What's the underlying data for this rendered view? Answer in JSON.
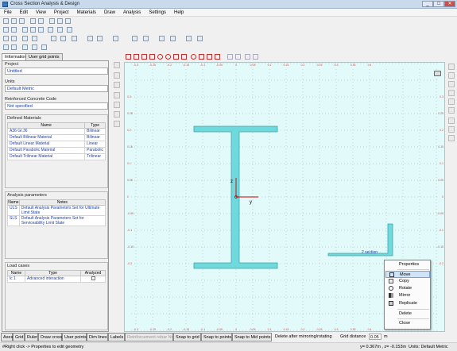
{
  "window": {
    "title": "Cross Section Analysis & Design",
    "controls": [
      "_",
      "□",
      "✕"
    ]
  },
  "menu": [
    "File",
    "Edit",
    "View",
    "Project",
    "Materials",
    "Draw",
    "Analysis",
    "Settings",
    "Help"
  ],
  "panel": {
    "tabs": [
      "Information",
      "User grid points"
    ],
    "project_label": "Project",
    "project_value": "Untitled",
    "units_label": "Units",
    "units_value": "Default Metric",
    "code_label": "Reinforced Concrete Code",
    "code_value": "Not specified",
    "materials": {
      "title": "Defined Materials",
      "headers": [
        "Name",
        "Type"
      ],
      "rows": [
        {
          "name": "A36 Gr.36",
          "type": "Bilinear"
        },
        {
          "name": "Default Bilinear Material",
          "type": "Bilinear"
        },
        {
          "name": "Default Linear Material",
          "type": "Linear"
        },
        {
          "name": "Default Parabolic Material",
          "type": "Parabolic"
        },
        {
          "name": "Default Trilinear Material",
          "type": "Trilinear"
        }
      ]
    },
    "analysis": {
      "title": "Analysis parameters",
      "headers": [
        "Name",
        "Notes"
      ],
      "rows": [
        {
          "name": "ULS",
          "notes": "Default Analysis Parameters Set for Ultimate Limit State"
        },
        {
          "name": "SLS",
          "notes": "Default Analysis Parameters Set for Serviceability Limit State"
        }
      ]
    },
    "loads": {
      "title": "Load cases",
      "headers": [
        "Name",
        "Type",
        "Analyzed"
      ],
      "rows": [
        {
          "name": "lc 1",
          "type": "Advanced interaction"
        }
      ]
    }
  },
  "canvas": {
    "x_ticks": [
      "-0.5",
      "-0.45",
      "-0.4",
      "-0.35",
      "-0.3",
      "-0.25",
      "-0.2",
      "-0.15",
      "-0.1",
      "-0.05",
      "0",
      "0.05",
      "0.1",
      "0.15",
      "0.2",
      "0.25",
      "0.3",
      "0.35",
      "0.4"
    ],
    "y_ticks": [
      "0.3",
      "0.25",
      "0.2",
      "0.15",
      "0.1",
      "0.05",
      "0",
      "-0.05",
      "-0.1",
      "-0.15",
      "-0.2"
    ],
    "axis_y": "y",
    "axis_z": "z",
    "section_label": "2 section",
    "colors": {
      "background": "#e3fafa",
      "section_fill": "#6fd9dd",
      "section_edge": "#3aa8ad",
      "axis": "#d00000",
      "grid_dot": "#f07070"
    }
  },
  "context_menu": [
    "Properties",
    "Move",
    "Copy",
    "Rotate",
    "Mirror",
    "Replicate",
    "Delete",
    "Close"
  ],
  "bottom_toggles": [
    "Axes",
    "Grid",
    "Ruler",
    "Draw cross",
    "User points",
    "Dim lines",
    "Labels",
    "Reinforcement rebar Nr.",
    "Snap to grid",
    "Snap to points",
    "Snap to Mid points"
  ],
  "delete_after": "Delete after mirroring/rotating",
  "grid_distance_label": "Grid distance",
  "grid_distance_value": "0.05",
  "grid_distance_unit": "m",
  "status": {
    "hint": "#Right click -> Properties to edit geometry",
    "coords": "y= 0.367m , z= -0.153m",
    "units": "Units: Default Metric"
  }
}
